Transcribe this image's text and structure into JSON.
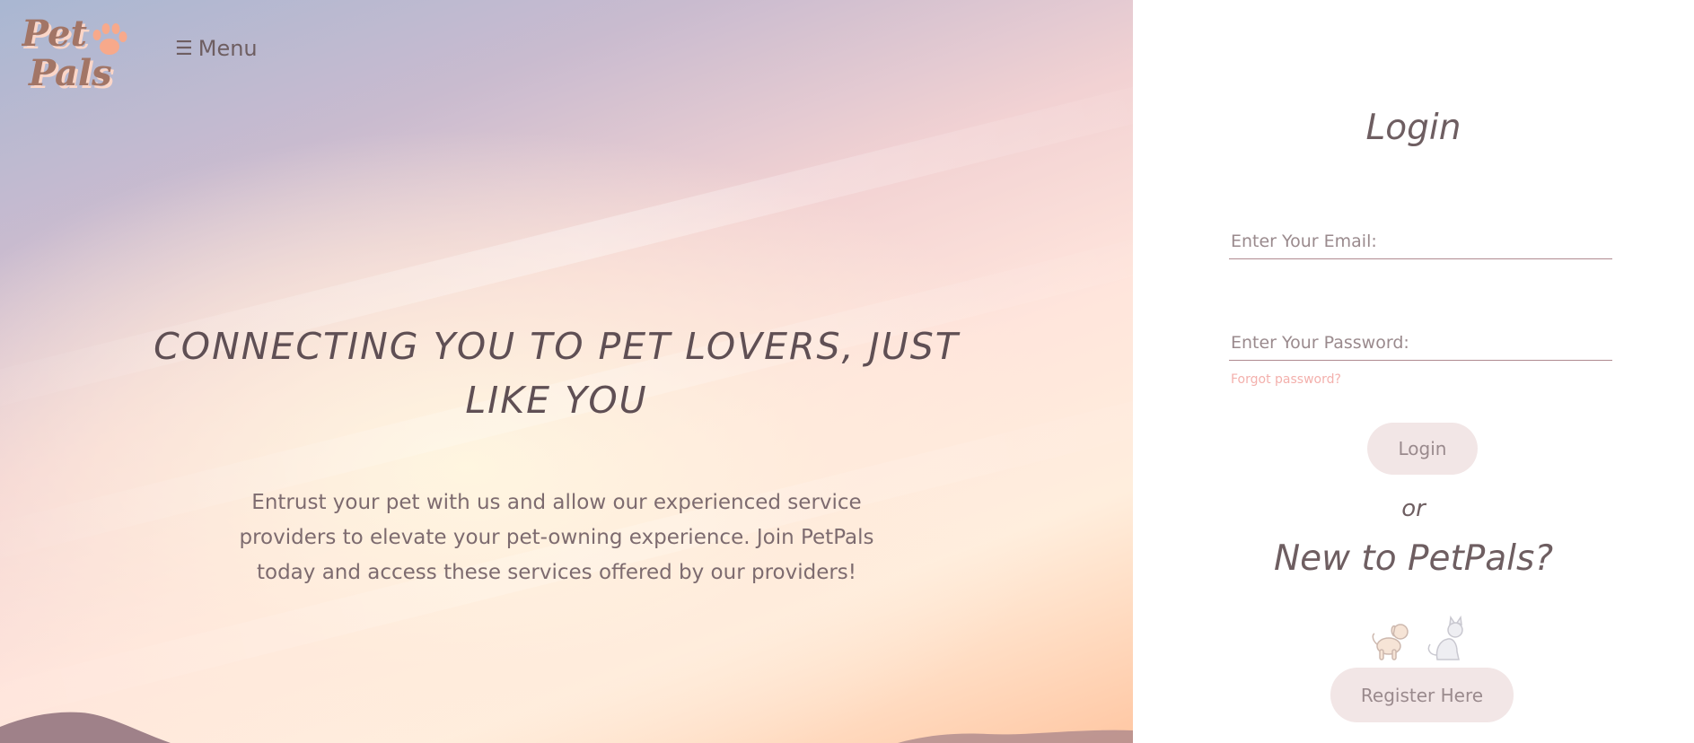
{
  "header": {
    "logo_text_line1": "Pet",
    "logo_text_line2": "Pals",
    "menu_label": "Menu",
    "menu_icon": "hamburger-icon"
  },
  "hero": {
    "headline": "CONNECTING YOU TO PET LOVERS, JUST LIKE YOU",
    "subtext": "Entrust your pet with us and allow our experienced service providers to elevate your pet-owning experience. Join PetPals today and access these services offered by our providers!"
  },
  "login": {
    "title": "Login",
    "email_placeholder": "Enter Your Email:",
    "email_value": "",
    "password_placeholder": "Enter Your Password:",
    "password_value": "",
    "forgot_label": "Forgot password?",
    "login_button": "Login",
    "or_label": "or",
    "new_title": "New to PetPals?",
    "register_button": "Register Here",
    "icons": [
      "dog-icon",
      "cat-icon"
    ]
  },
  "colors": {
    "text_dark": "#6e5e61",
    "accent_pink": "#f3b0ac",
    "button_bg": "#f2e6e6",
    "logo_brown": "#a27566"
  }
}
